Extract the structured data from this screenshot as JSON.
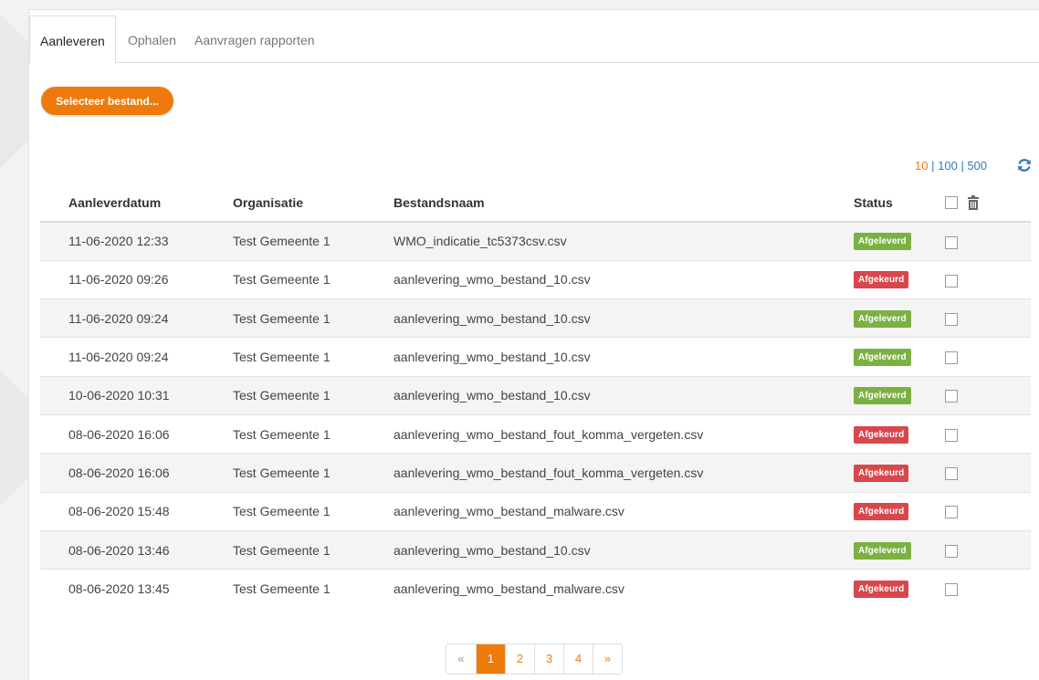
{
  "tabs": [
    {
      "label": "Aanleveren",
      "active": true
    },
    {
      "label": "Ophalen",
      "active": false
    },
    {
      "label": "Aanvragen rapporten",
      "active": false
    }
  ],
  "select_button": "Selecteer bestand...",
  "page_size": {
    "options": [
      "10",
      "100",
      "500"
    ],
    "current": "10",
    "separator": "|"
  },
  "icons": {
    "refresh": "refresh-icon",
    "trash": "trash-icon"
  },
  "colors": {
    "accent": "#ef7a0c",
    "ok": "#7bb043",
    "error": "#d9464b",
    "link": "#337ab7"
  },
  "table": {
    "headers": [
      "Aanleverdatum",
      "Organisatie",
      "Bestandsnaam",
      "Status"
    ],
    "rows": [
      {
        "date": "11-06-2020 12:33",
        "org": "Test Gemeente 1",
        "file": "WMO_indicatie_tc5373csv.csv",
        "status": "Afgeleverd"
      },
      {
        "date": "11-06-2020 09:26",
        "org": "Test Gemeente 1",
        "file": "aanlevering_wmo_bestand_10.csv",
        "status": "Afgekeurd"
      },
      {
        "date": "11-06-2020 09:24",
        "org": "Test Gemeente 1",
        "file": "aanlevering_wmo_bestand_10.csv",
        "status": "Afgeleverd"
      },
      {
        "date": "11-06-2020 09:24",
        "org": "Test Gemeente 1",
        "file": "aanlevering_wmo_bestand_10.csv",
        "status": "Afgeleverd"
      },
      {
        "date": "10-06-2020 10:31",
        "org": "Test Gemeente 1",
        "file": "aanlevering_wmo_bestand_10.csv",
        "status": "Afgeleverd"
      },
      {
        "date": "08-06-2020 16:06",
        "org": "Test Gemeente 1",
        "file": "aanlevering_wmo_bestand_fout_komma_vergeten.csv",
        "status": "Afgekeurd"
      },
      {
        "date": "08-06-2020 16:06",
        "org": "Test Gemeente 1",
        "file": "aanlevering_wmo_bestand_fout_komma_vergeten.csv",
        "status": "Afgekeurd"
      },
      {
        "date": "08-06-2020 15:48",
        "org": "Test Gemeente 1",
        "file": "aanlevering_wmo_bestand_malware.csv",
        "status": "Afgekeurd"
      },
      {
        "date": "08-06-2020 13:46",
        "org": "Test Gemeente 1",
        "file": "aanlevering_wmo_bestand_10.csv",
        "status": "Afgeleverd"
      },
      {
        "date": "08-06-2020 13:45",
        "org": "Test Gemeente 1",
        "file": "aanlevering_wmo_bestand_malware.csv",
        "status": "Afgekeurd"
      }
    ]
  },
  "pagination": {
    "prev": "«",
    "pages": [
      "1",
      "2",
      "3",
      "4"
    ],
    "current": "1",
    "next": "»"
  }
}
